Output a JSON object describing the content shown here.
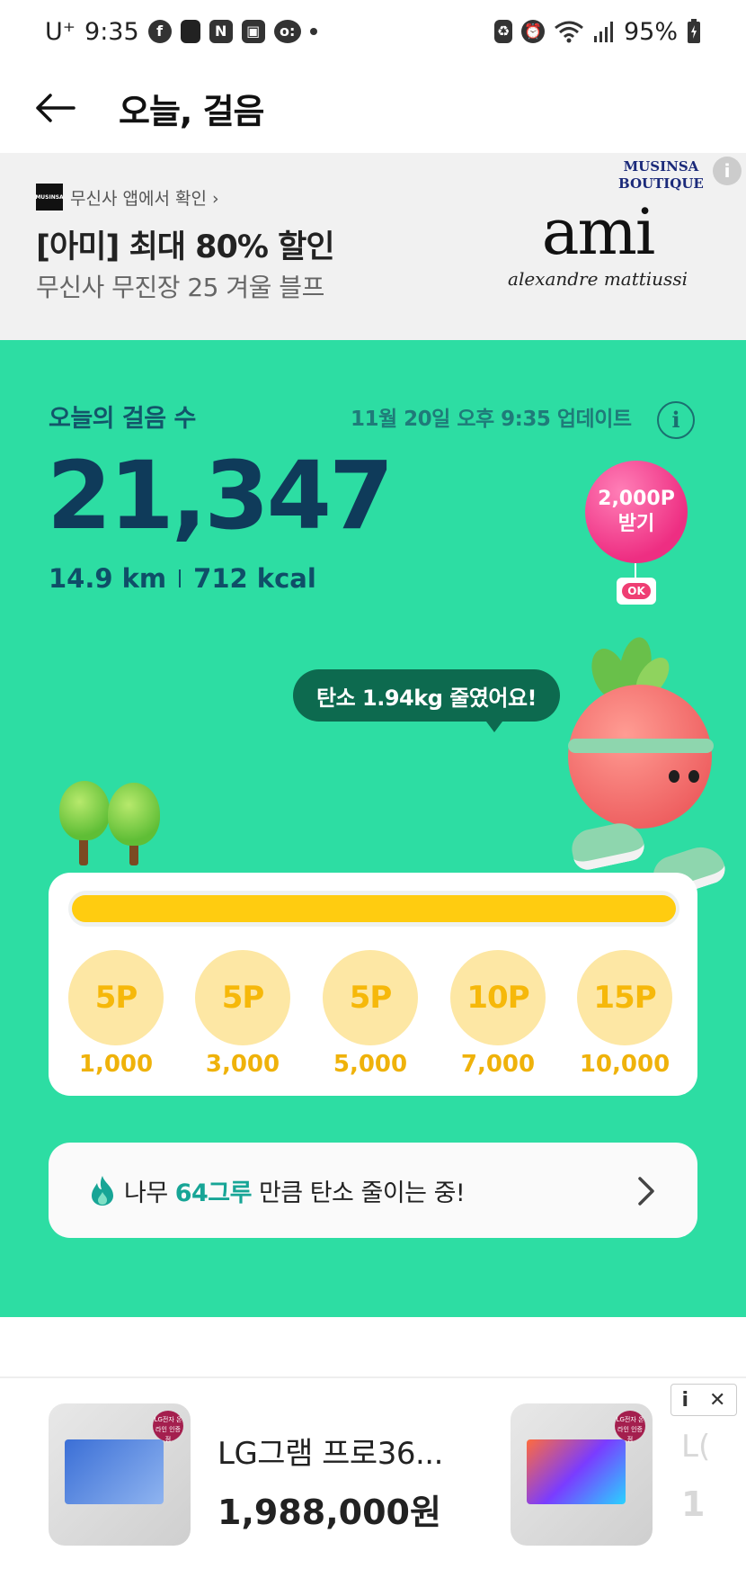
{
  "status_bar": {
    "carrier": "U⁺",
    "time": "9:35",
    "battery": "95%"
  },
  "header": {
    "title": "오늘, 걸음"
  },
  "top_ad": {
    "source_label": "무신사 앱에서 확인 ›",
    "title": "[아미] 최대 80% 할인",
    "subtitle": "무신사 무진장 25 겨울 블프",
    "logo_text": "MUSINSA",
    "boutique_line1": "MUSINSA",
    "boutique_line2": "BOUTIQUE",
    "brand_big": "ami",
    "brand_small": "alexandre mattiussi"
  },
  "walk": {
    "label": "오늘의 걸음 수",
    "update_text": "11월 20일 오후 9:35 업데이트",
    "info_icon": "i",
    "steps": "21,347",
    "distance": "14.9 km",
    "calories": "712 kcal",
    "balloon_line1": "2,000P",
    "balloon_line2": "받기",
    "balloon_tag": "OK",
    "bubble": "탄소 1.94kg 줄였어요!",
    "progress_fraction": 1.0
  },
  "rewards": [
    {
      "points": "5P",
      "steps": "1,000"
    },
    {
      "points": "5P",
      "steps": "3,000"
    },
    {
      "points": "5P",
      "steps": "5,000"
    },
    {
      "points": "10P",
      "steps": "7,000"
    },
    {
      "points": "15P",
      "steps": "10,000"
    }
  ],
  "carbon": {
    "prefix": "나무",
    "highlight": "64그루",
    "suffix": "만큼 탄소 줄이는 중!"
  },
  "bottom_ad": {
    "product_name": "LG그램 프로36...",
    "price": "1,988,000원",
    "badge_text": "LG전자 온라인 인증점",
    "ghost_name": "L(",
    "ghost_price": "1",
    "info_label": "i",
    "close_label": "✕"
  },
  "colors": {
    "green_bg": "#2ddda3",
    "progress": "#ffcc10",
    "balloon": "#ee2e82",
    "highlight": "#17a596"
  }
}
